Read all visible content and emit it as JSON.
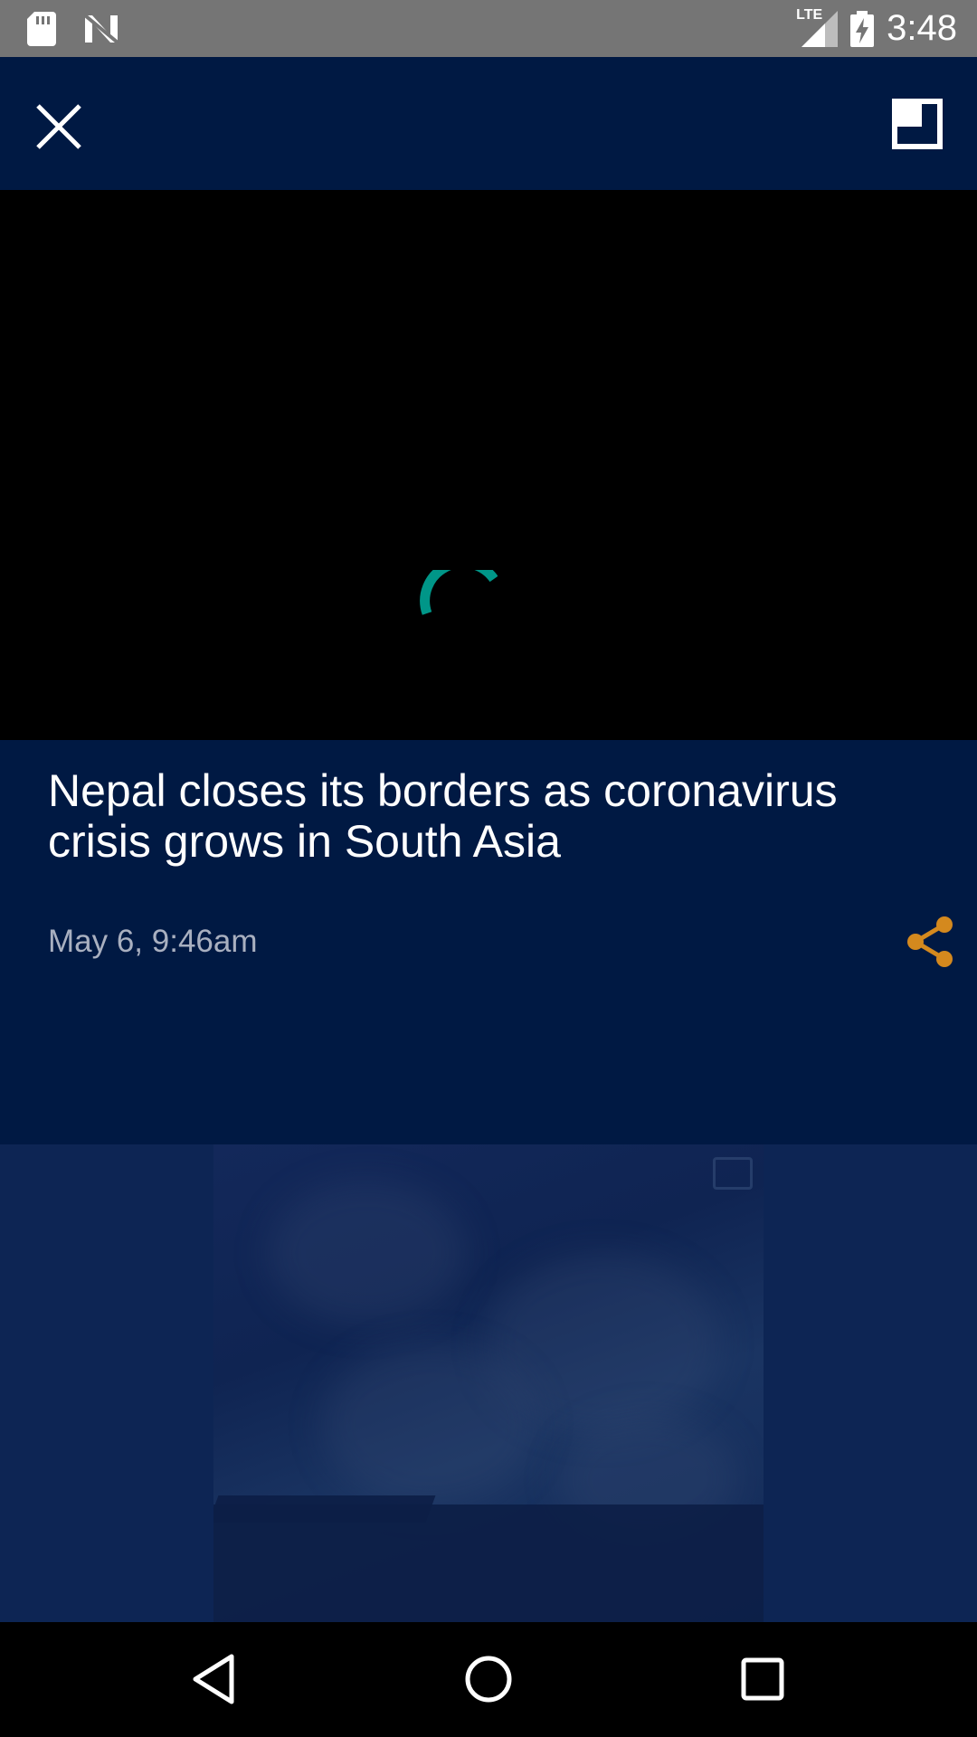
{
  "status_bar": {
    "time": "3:48",
    "network": "LTE",
    "icons": [
      "sd-card-icon",
      "n-notification-icon",
      "lte-signal-icon",
      "battery-charging-icon"
    ]
  },
  "toolbar": {
    "close_icon": "close-icon",
    "pip_icon": "picture-in-picture-icon"
  },
  "video": {
    "state": "loading",
    "spinner_color": "#009688"
  },
  "article": {
    "headline": "Nepal closes its borders as coronavirus crisis grows in South Asia",
    "timestamp": "May 6, 9:46am",
    "share_icon": "share-icon",
    "share_color": "#d4891e"
  },
  "nav_bar": {
    "buttons": [
      "back-icon",
      "home-icon",
      "recents-icon"
    ]
  },
  "colors": {
    "brand_navy": "#001943",
    "status_bar": "#757575"
  }
}
